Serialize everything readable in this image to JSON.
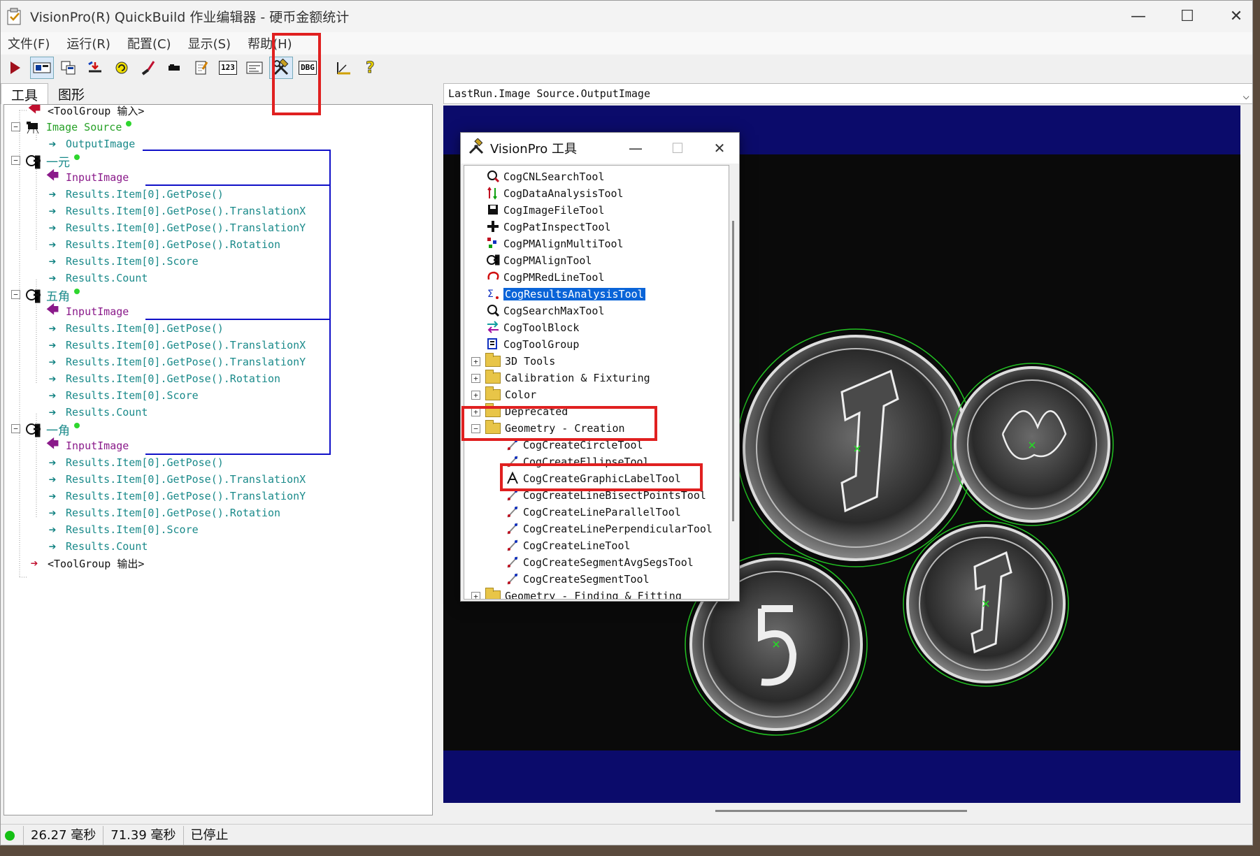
{
  "window": {
    "title": "VisionPro(R) QuickBuild 作业编辑器 - 硬币金额统计",
    "controls": [
      "—",
      "☐",
      "✕"
    ]
  },
  "menu": [
    "文件(F)",
    "运行(R)",
    "配置(C)",
    "显示(S)",
    "帮助(H)"
  ],
  "toolbar": {
    "buttons": [
      "run-icon",
      "display-icon",
      "windows-icon",
      "reset-icon",
      "refresh-icon",
      "draw-icon",
      "record-icon",
      "edit-icon",
      "number-icon",
      "form-icon",
      "tools-icon",
      "dbg-icon",
      "ruler-icon",
      "help-icon"
    ],
    "number_label": "123",
    "dbg_label": "DBG"
  },
  "tabs": [
    "工具",
    "图形"
  ],
  "tree": {
    "input_group": "<ToolGroup 输入>",
    "image_source": "Image Source",
    "output_image": "OutputImage",
    "output_group": "<ToolGroup 输出>",
    "tools": [
      {
        "name": "一元",
        "input": "InputImage",
        "results": [
          "Results.Item[0].GetPose()",
          "Results.Item[0].GetPose().TranslationX",
          "Results.Item[0].GetPose().TranslationY",
          "Results.Item[0].GetPose().Rotation",
          "Results.Item[0].Score",
          "Results.Count"
        ]
      },
      {
        "name": "五角",
        "input": "InputImage",
        "results": [
          "Results.Item[0].GetPose()",
          "Results.Item[0].GetPose().TranslationX",
          "Results.Item[0].GetPose().TranslationY",
          "Results.Item[0].GetPose().Rotation",
          "Results.Item[0].Score",
          "Results.Count"
        ]
      },
      {
        "name": "一角",
        "input": "InputImage",
        "results": [
          "Results.Item[0].GetPose()",
          "Results.Item[0].GetPose().TranslationX",
          "Results.Item[0].GetPose().TranslationY",
          "Results.Item[0].GetPose().Rotation",
          "Results.Item[0].Score",
          "Results.Count"
        ]
      }
    ]
  },
  "image_selector": {
    "value": "LastRun.Image Source.OutputImage"
  },
  "dialog": {
    "title": "VisionPro 工具",
    "items": [
      {
        "label": "CogCNLSearchTool",
        "icon": "search-icon"
      },
      {
        "label": "CogDataAnalysisTool",
        "icon": "data-icon"
      },
      {
        "label": "CogImageFileTool",
        "icon": "file-icon"
      },
      {
        "label": "CogPatInspectTool",
        "icon": "cross-icon"
      },
      {
        "label": "CogPMAlignMultiTool",
        "icon": "multi-align-icon"
      },
      {
        "label": "CogPMAlignTool",
        "icon": "align-icon"
      },
      {
        "label": "CogPMRedLineTool",
        "icon": "redline-icon"
      },
      {
        "label": "CogResultsAnalysisTool",
        "icon": "sigma-icon",
        "selected": true
      },
      {
        "label": "CogSearchMaxTool",
        "icon": "searchmax-icon"
      },
      {
        "label": "CogToolBlock",
        "icon": "block-icon"
      },
      {
        "label": "CogToolGroup",
        "icon": "group-icon"
      }
    ],
    "folders": [
      "3D Tools",
      "Calibration & Fixturing",
      "Color",
      "Deprecated",
      "Geometry - Creation"
    ],
    "geometry_items": [
      "CogCreateCircleTool",
      "CogCreateEllipseTool",
      "CogCreateGraphicLabelTool",
      "CogCreateLineBisectPointsTool",
      "CogCreateLineParallelTool",
      "CogCreateLinePerpendicularTool",
      "CogCreateLineTool",
      "CogCreateSegmentAvgSegsTool",
      "CogCreateSegmentTool"
    ],
    "last_folder": "Geometry - Finding & Fitting"
  },
  "status": {
    "time1": "26.27 毫秒",
    "time2": "71.39 毫秒",
    "state": "已停止",
    "led_color": "#15c015"
  },
  "colors": {
    "highlight": "#e02020",
    "navy": "#0b0b6b",
    "selection": "#0a64d8",
    "link_line": "#1010c8"
  }
}
